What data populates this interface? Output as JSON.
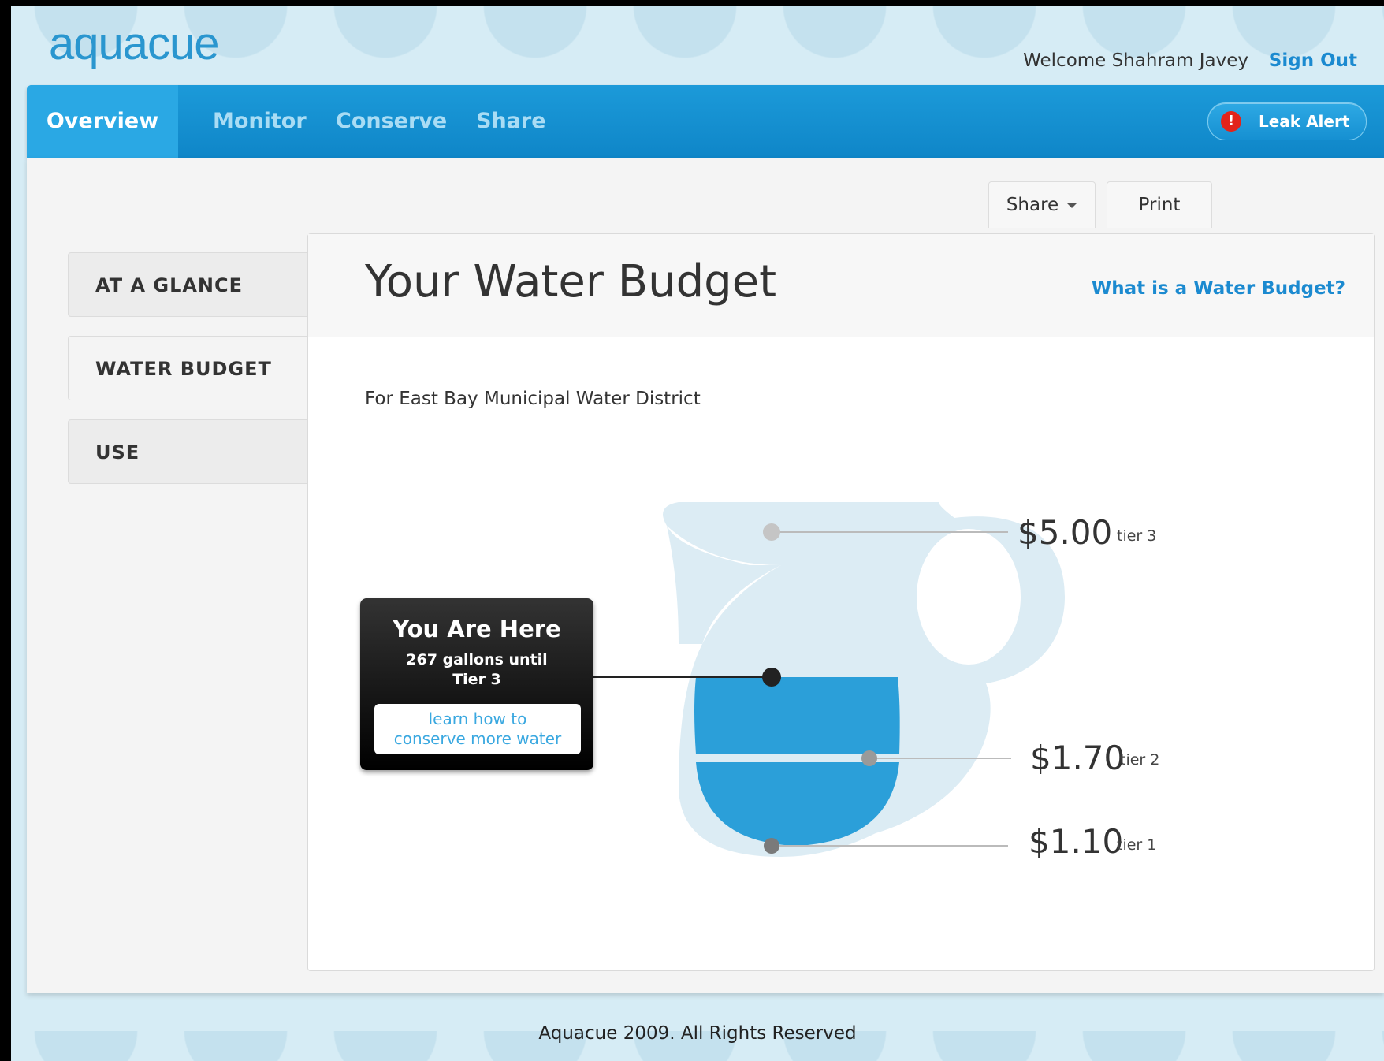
{
  "header": {
    "logo": "aquacue",
    "welcome": "Welcome Shahram Javey",
    "sign_out": "Sign Out"
  },
  "nav": {
    "tabs": [
      {
        "label": "Overview",
        "active": true
      },
      {
        "label": "Monitor",
        "active": false
      },
      {
        "label": "Conserve",
        "active": false
      },
      {
        "label": "Share",
        "active": false
      }
    ],
    "leak_alert": "Leak Alert"
  },
  "toolbar": {
    "share": "Share",
    "print": "Print"
  },
  "sidebar": {
    "items": [
      {
        "label": "AT A GLANCE",
        "selected": false
      },
      {
        "label": "WATER BUDGET",
        "selected": true
      },
      {
        "label": "USE",
        "selected": false
      }
    ]
  },
  "main": {
    "title": "Your Water Budget",
    "help_link": "What is a Water Budget?",
    "district": "For East Bay Municipal Water District",
    "you_are_here": {
      "heading": "You Are Here",
      "line1": "267 gallons until",
      "line2": "Tier 3",
      "button_line1": "learn how to",
      "button_line2": "conserve more water"
    },
    "tiers": [
      {
        "price": "$5.00",
        "label": "tier 3"
      },
      {
        "price": "$1.70",
        "label": "tier 2"
      },
      {
        "price": "$1.10",
        "label": "tier 1"
      }
    ]
  },
  "colors": {
    "brand": "#1b8ad0",
    "nav": "#1c9ad9",
    "water": "#2b9fd9",
    "jug": "#dcecf4",
    "alert": "#e2231a"
  },
  "footer": "Aquacue 2009. All Rights Reserved"
}
